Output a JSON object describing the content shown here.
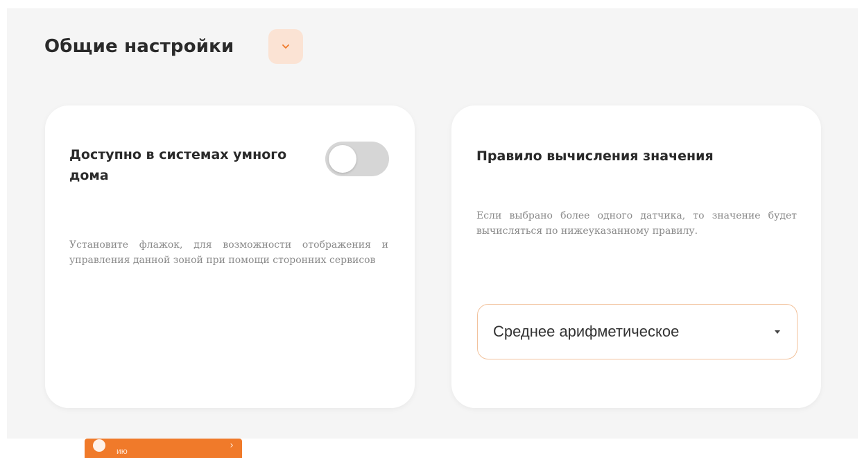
{
  "section": {
    "title": "Общие настройки",
    "collapse_icon": "chevron-down-icon"
  },
  "smart_home_card": {
    "title": "Доступно в системах умного дома",
    "description": "Установите флажок, для возможности отображения и управления данной зоной при помощи сторонних сервисов",
    "toggle_state": "off"
  },
  "rule_card": {
    "title": "Правило вычисления значения",
    "description": "Если выбрано более одного датчика, то значение будет вычисляться по нижеуказанному правилу.",
    "select": {
      "selected": "Среднее арифметическое"
    }
  },
  "bottom_button": {
    "label": "ию",
    "arrow": "›"
  },
  "colors": {
    "accent": "#f07a2a",
    "accent_soft": "#fbe3d4",
    "select_border": "#f2c29c",
    "panel_bg": "#f5f5f5",
    "card_bg": "#ffffff",
    "toggle_off": "#d6d6d6"
  }
}
